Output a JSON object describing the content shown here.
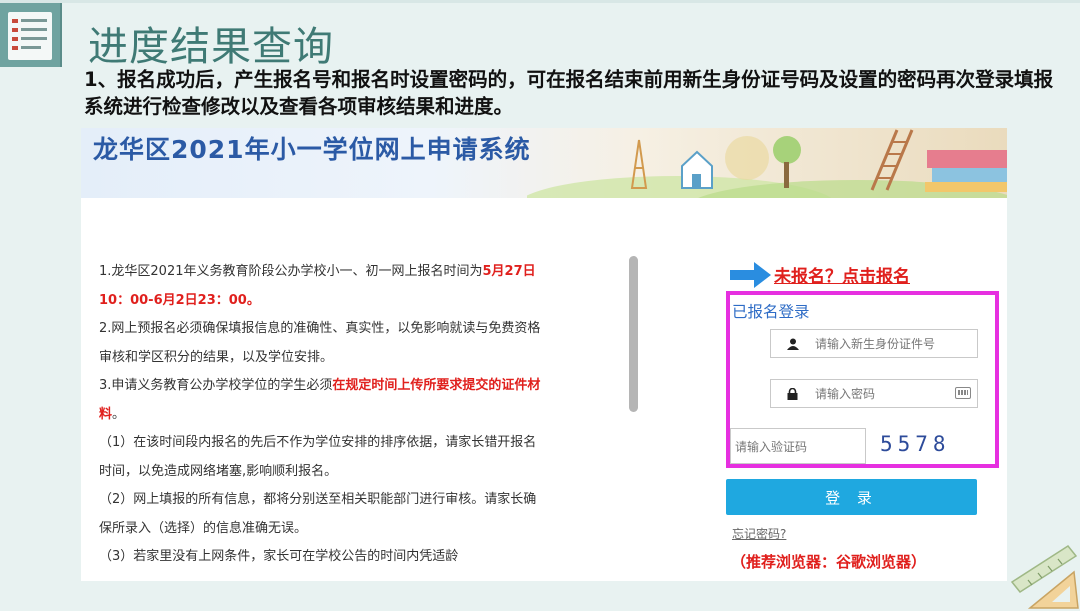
{
  "slide": {
    "title": "进度结果查询",
    "intro": "1、报名成功后，产生报名号和报名时设置密码的，可在报名结束前用新生身份证号码及设置的密码再次登录填报系统进行检查修改以及查看各项审核结果和进度。"
  },
  "banner": {
    "title": "龙华区2021年小一学位网上申请系统"
  },
  "notice": {
    "p1_a": "1.龙华区2021年义务教育阶段公办学校小一、初一网上报名时间为",
    "p1_red": "5月27日10：00-6月2日23：00。",
    "p2": "2.网上预报名必须确保填报信息的准确性、真实性，以免影响就读与免费资格审核和学区积分的结果，以及学位安排。",
    "p3_a": "3.申请义务教育公办学校学位的学生必须",
    "p3_red": "在规定时间上传所要求提交的证件材料",
    "p3_b": "。",
    "p4": "（1）在该时间段内报名的先后不作为学位安排的排序依据，请家长错开报名时间，以免造成网络堵塞,影响顺利报名。",
    "p5": "（2）网上填报的所有信息，都将分别送至相关职能部门进行审核。请家长确保所录入（选择）的信息准确无误。",
    "p6": "（3）若家里没有上网条件，家长可在学校公告的时间内凭适龄"
  },
  "login": {
    "register_link": "未报名？点击报名",
    "title": "已报名登录",
    "id_placeholder": "请输入新生身份证件号",
    "password_placeholder": "请输入密码",
    "captcha_placeholder": "请输入验证码",
    "captcha_code": "5578",
    "login_button": "登 录",
    "forgot_link": "忘记密码?",
    "browser_tip": "（推荐浏览器：谷歌浏览器）"
  },
  "colors": {
    "accent_teal": "#3f7a75",
    "link_blue": "#2e6cc6",
    "highlight_magenta": "#e62fe0",
    "button_blue": "#1fa8e0",
    "warning_red": "#e0201d"
  },
  "icons": [
    "document-list-icon",
    "user-icon",
    "lock-icon",
    "keyboard-icon",
    "arrow-right-icon",
    "ruler-icon"
  ]
}
